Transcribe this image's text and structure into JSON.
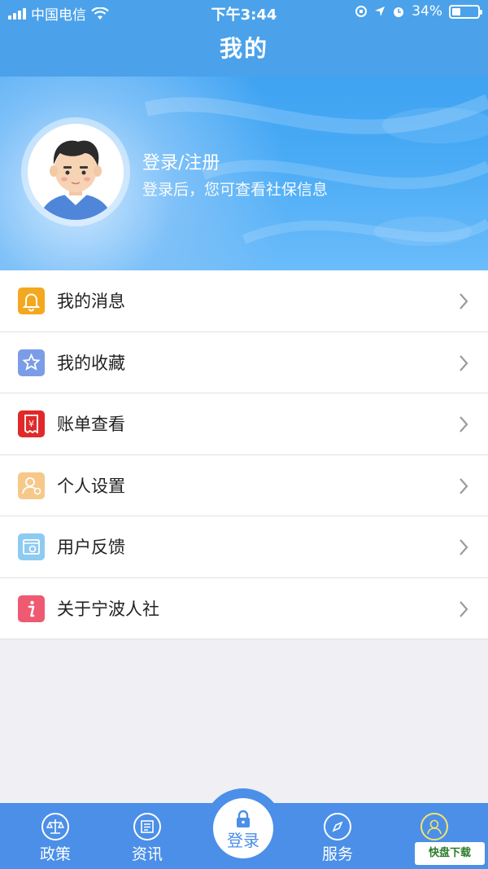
{
  "status_bar": {
    "carrier": "中国电信",
    "time": "下午3:44",
    "battery_percent_text": "34%",
    "battery_level": 0.34
  },
  "nav": {
    "title": "我的"
  },
  "profile": {
    "login_title": "登录/注册",
    "login_subtitle": "登录后，您可查看社保信息"
  },
  "menu": [
    {
      "label": "我的消息",
      "icon": "bell-icon",
      "color": "#f4a81f"
    },
    {
      "label": "我的收藏",
      "icon": "star-icon",
      "color": "#7b9de8"
    },
    {
      "label": "账单查看",
      "icon": "yuan-bill-icon",
      "color": "#e02a2a"
    },
    {
      "label": "个人设置",
      "icon": "person-settings-icon",
      "color": "#f6c98b"
    },
    {
      "label": "用户反馈",
      "icon": "feedback-icon",
      "color": "#8dcbf2"
    },
    {
      "label": "关于宁波人社",
      "icon": "info-icon",
      "color": "#ee5a72"
    }
  ],
  "tabs": [
    {
      "label": "政策",
      "icon": "scale-icon"
    },
    {
      "label": "资讯",
      "icon": "news-icon"
    },
    {
      "label": "登录",
      "icon": "lock-icon"
    },
    {
      "label": "服务",
      "icon": "compass-icon"
    },
    {
      "label": "",
      "icon": "user-icon"
    }
  ],
  "watermark": {
    "text": "快盘下载"
  },
  "colors": {
    "primary": "#4ba2ea",
    "tabbar": "#4b8fe8",
    "background": "#efeff4"
  }
}
